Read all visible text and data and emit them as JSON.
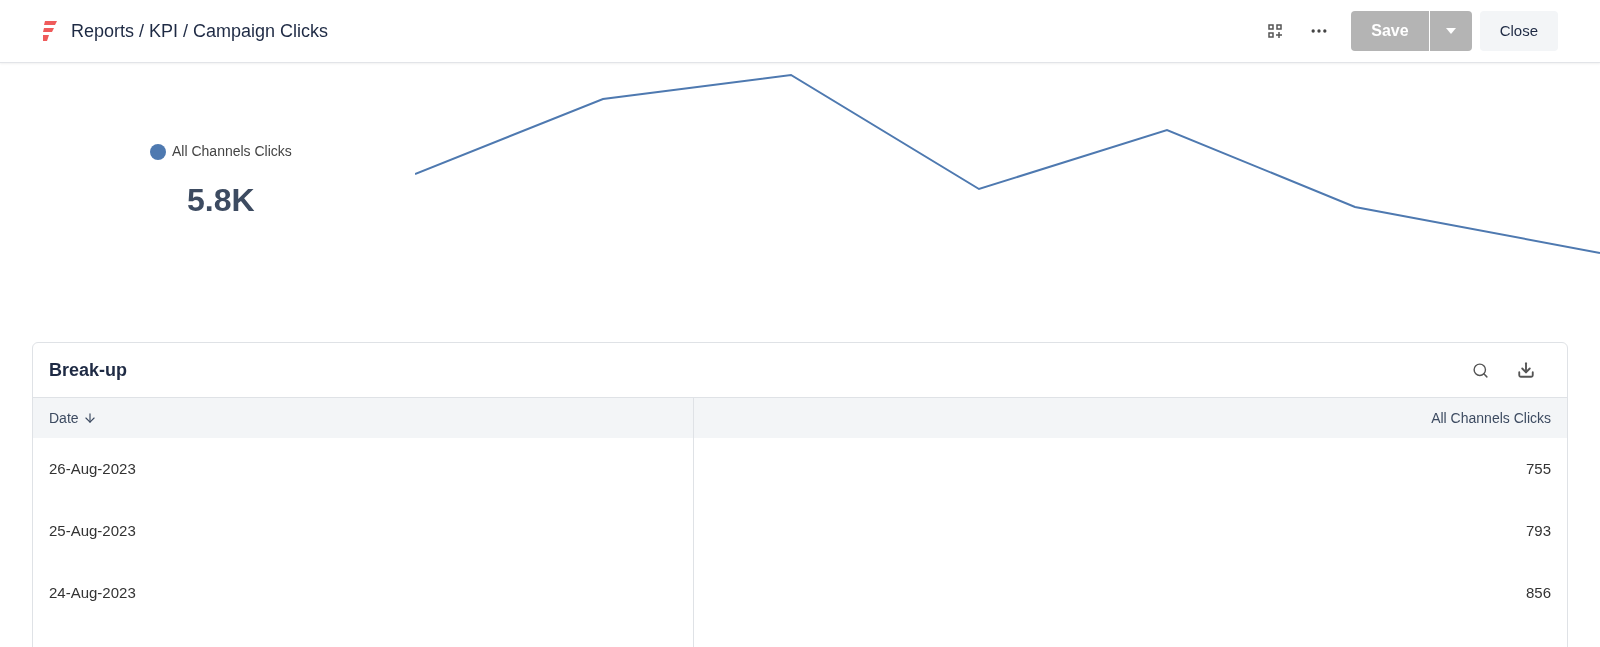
{
  "header": {
    "breadcrumb": "Reports / KPI / Campaign Clicks",
    "save_button": "Save",
    "close_button": "Close",
    "save_disabled": true
  },
  "kpi": {
    "legend": "All Channels Clicks",
    "color": "#4e79b0",
    "value": "5.8K"
  },
  "breakup": {
    "title": "Break-up",
    "columns": [
      {
        "label": "Date",
        "sorted": true
      },
      {
        "label": "All Channels Clicks",
        "sorted": false
      }
    ],
    "rows": [
      [
        "26-Aug-2023",
        "755"
      ],
      [
        "25-Aug-2023",
        "793"
      ],
      [
        "24-Aug-2023",
        "856"
      ]
    ]
  }
}
